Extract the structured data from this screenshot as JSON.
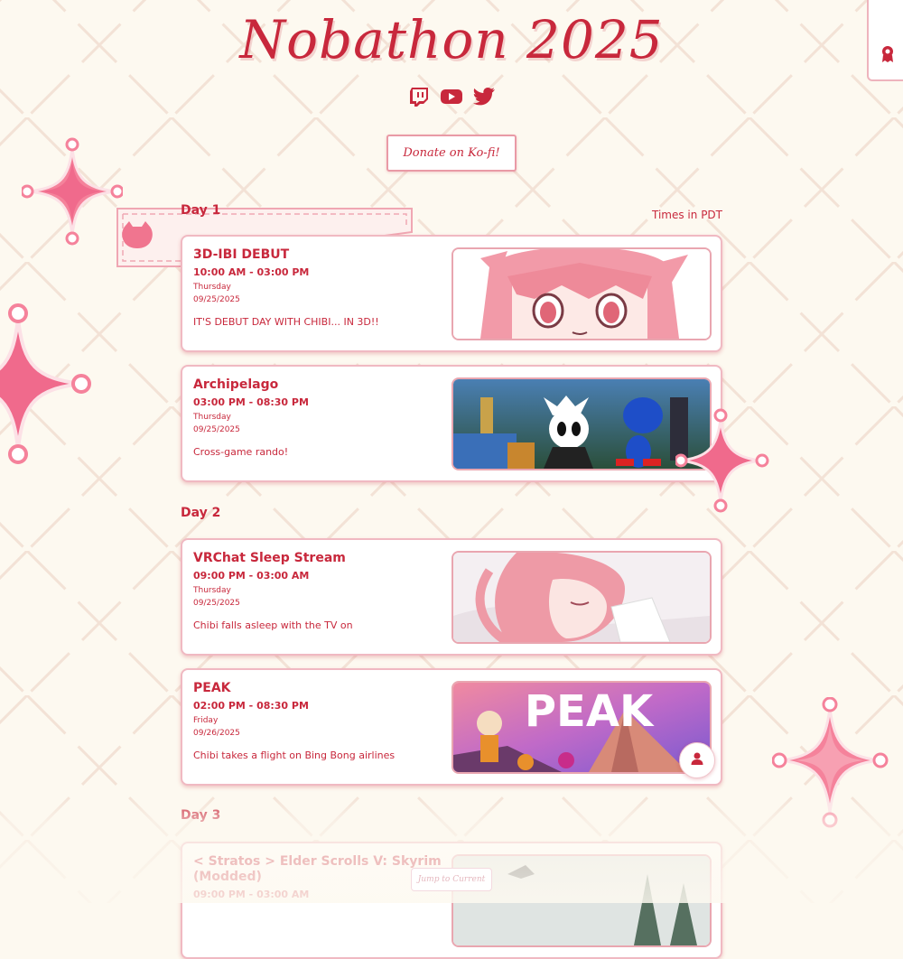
{
  "header": {
    "title": "Nobathon 2025",
    "donate_label": "Donate on Ko-fi!",
    "socials": [
      "twitch-icon",
      "youtube-icon",
      "twitter-icon"
    ]
  },
  "side_tab": {
    "icon": "ribbon-badge-icon"
  },
  "schedule": {
    "timezone_note": "Times in PDT",
    "days": [
      {
        "label": "Day 1"
      },
      {
        "label": "Day 2"
      },
      {
        "label": "Day 3"
      }
    ],
    "events": [
      {
        "title": "3D-IBI DEBUT",
        "time": "10:00 AM - 03:00 PM",
        "weekday": "Thursday",
        "date": "09/25/2025",
        "description": "IT'S DEBUT DAY WITH CHIBI... IN 3D!!"
      },
      {
        "title": "Archipelago",
        "time": "03:00 PM - 08:30 PM",
        "weekday": "Thursday",
        "date": "09/25/2025",
        "description": "Cross-game rando!"
      },
      {
        "title": "VRChat Sleep Stream",
        "time": "09:00 PM - 03:00 AM",
        "weekday": "Thursday",
        "date": "09/25/2025",
        "description": "Chibi falls asleep with the TV on"
      },
      {
        "title": "PEAK",
        "time": "02:00 PM - 08:30 PM",
        "weekday": "Friday",
        "date": "09/26/2025",
        "description": "Chibi takes a flight on Bing Bong airlines",
        "image_text": "PEAK"
      },
      {
        "title": "< Stratos > Elder Scrolls V: Skyrim (Modded)",
        "time": "09:00 PM - 03:00 AM"
      }
    ]
  },
  "jump_label": "Jump to Current",
  "colors": {
    "accent": "#c8283c",
    "pink": "#f06a8c",
    "background": "#fdf9f0",
    "border": "#f0b9c2"
  }
}
